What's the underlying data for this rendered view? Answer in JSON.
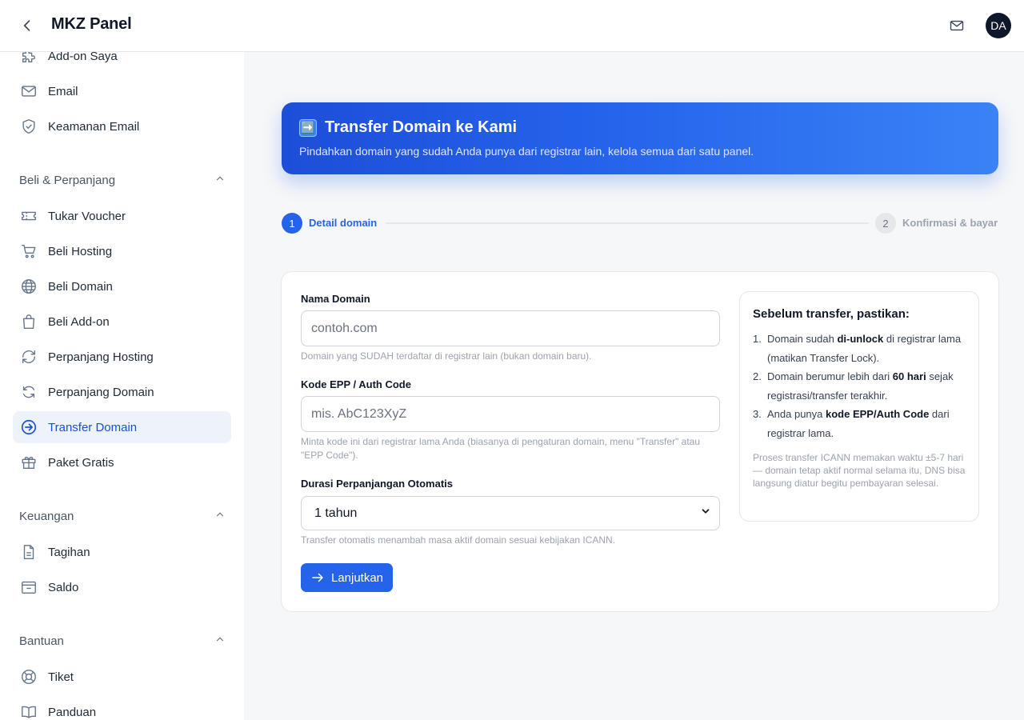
{
  "header": {
    "title": "MKZ Panel",
    "avatar_initials": "DA",
    "icons": {
      "back": "chevron-left-icon",
      "mail": "mail-icon"
    }
  },
  "sidebar": {
    "items_top": [
      {
        "label": "Add-on Saya",
        "icon": "puzzle-icon"
      },
      {
        "label": "Email",
        "icon": "mail-icon"
      },
      {
        "label": "Keamanan Email",
        "icon": "shield-check-icon"
      }
    ],
    "sections": [
      {
        "title": "Beli & Perpanjang",
        "items": [
          {
            "label": "Tukar Voucher",
            "icon": "ticket-icon"
          },
          {
            "label": "Beli Hosting",
            "icon": "cart-icon"
          },
          {
            "label": "Beli Domain",
            "icon": "globe-icon"
          },
          {
            "label": "Beli Add-on",
            "icon": "bag-icon"
          },
          {
            "label": "Perpanjang Hosting",
            "icon": "refresh-icon"
          },
          {
            "label": "Perpanjang Domain",
            "icon": "renew-icon"
          },
          {
            "label": "Transfer Domain",
            "icon": "arrow-circle-icon",
            "active": true
          },
          {
            "label": "Paket Gratis",
            "icon": "gift-icon"
          }
        ]
      },
      {
        "title": "Keuangan",
        "items": [
          {
            "label": "Tagihan",
            "icon": "file-icon"
          },
          {
            "label": "Saldo",
            "icon": "wallet-icon"
          }
        ]
      },
      {
        "title": "Bantuan",
        "items": [
          {
            "label": "Tiket",
            "icon": "lifebuoy-icon"
          },
          {
            "label": "Panduan",
            "icon": "book-icon"
          }
        ]
      }
    ]
  },
  "banner": {
    "emoji": "➡️",
    "title": "Transfer Domain ke Kami",
    "subtitle": "Pindahkan domain yang sudah Anda punya dari registrar lain, kelola semua dari satu panel."
  },
  "stepper": {
    "steps": [
      {
        "number": "1",
        "label": "Detail domain",
        "state": "active"
      },
      {
        "number": "2",
        "label": "Konfirmasi & bayar",
        "state": "inactive"
      }
    ]
  },
  "form": {
    "domain": {
      "label": "Nama Domain",
      "placeholder": "contoh.com",
      "value": "",
      "help": "Domain yang SUDAH terdaftar di registrar lain (bukan domain baru)."
    },
    "epp": {
      "label": "Kode EPP / Auth Code",
      "placeholder": "mis. AbC123XyZ",
      "value": "",
      "help": "Minta kode ini dari registrar lama Anda (biasanya di pengaturan domain, menu \"Transfer\" atau \"EPP Code\")."
    },
    "duration": {
      "label": "Durasi Perpanjangan Otomatis",
      "selected": "1 tahun",
      "help": "Transfer otomatis menambah masa aktif domain sesuai kebijakan ICANN."
    },
    "submit_label": "Lanjutkan"
  },
  "info": {
    "title": "Sebelum transfer, pastikan:",
    "items": [
      {
        "num": "1.",
        "before": "Domain sudah ",
        "bold": "di-unlock",
        "after": " di registrar lama (matikan Transfer Lock)."
      },
      {
        "num": "2.",
        "before": "Domain berumur lebih dari ",
        "bold": "60 hari",
        "after": " sejak registrasi/transfer terakhir."
      },
      {
        "num": "3.",
        "before": "Anda punya ",
        "bold": "kode EPP/Auth Code",
        "after": " dari registrar lama."
      }
    ],
    "note": "Proses transfer ICANN memakan waktu ±5-7 hari — domain tetap aktif normal selama itu, DNS bisa langsung diatur begitu pembayaran selesai."
  },
  "colors": {
    "accent": "#2563eb",
    "active_nav_bg": "#eef2f9",
    "banner_gradient_start": "#1d4ed8",
    "banner_gradient_end": "#3b82f6"
  }
}
